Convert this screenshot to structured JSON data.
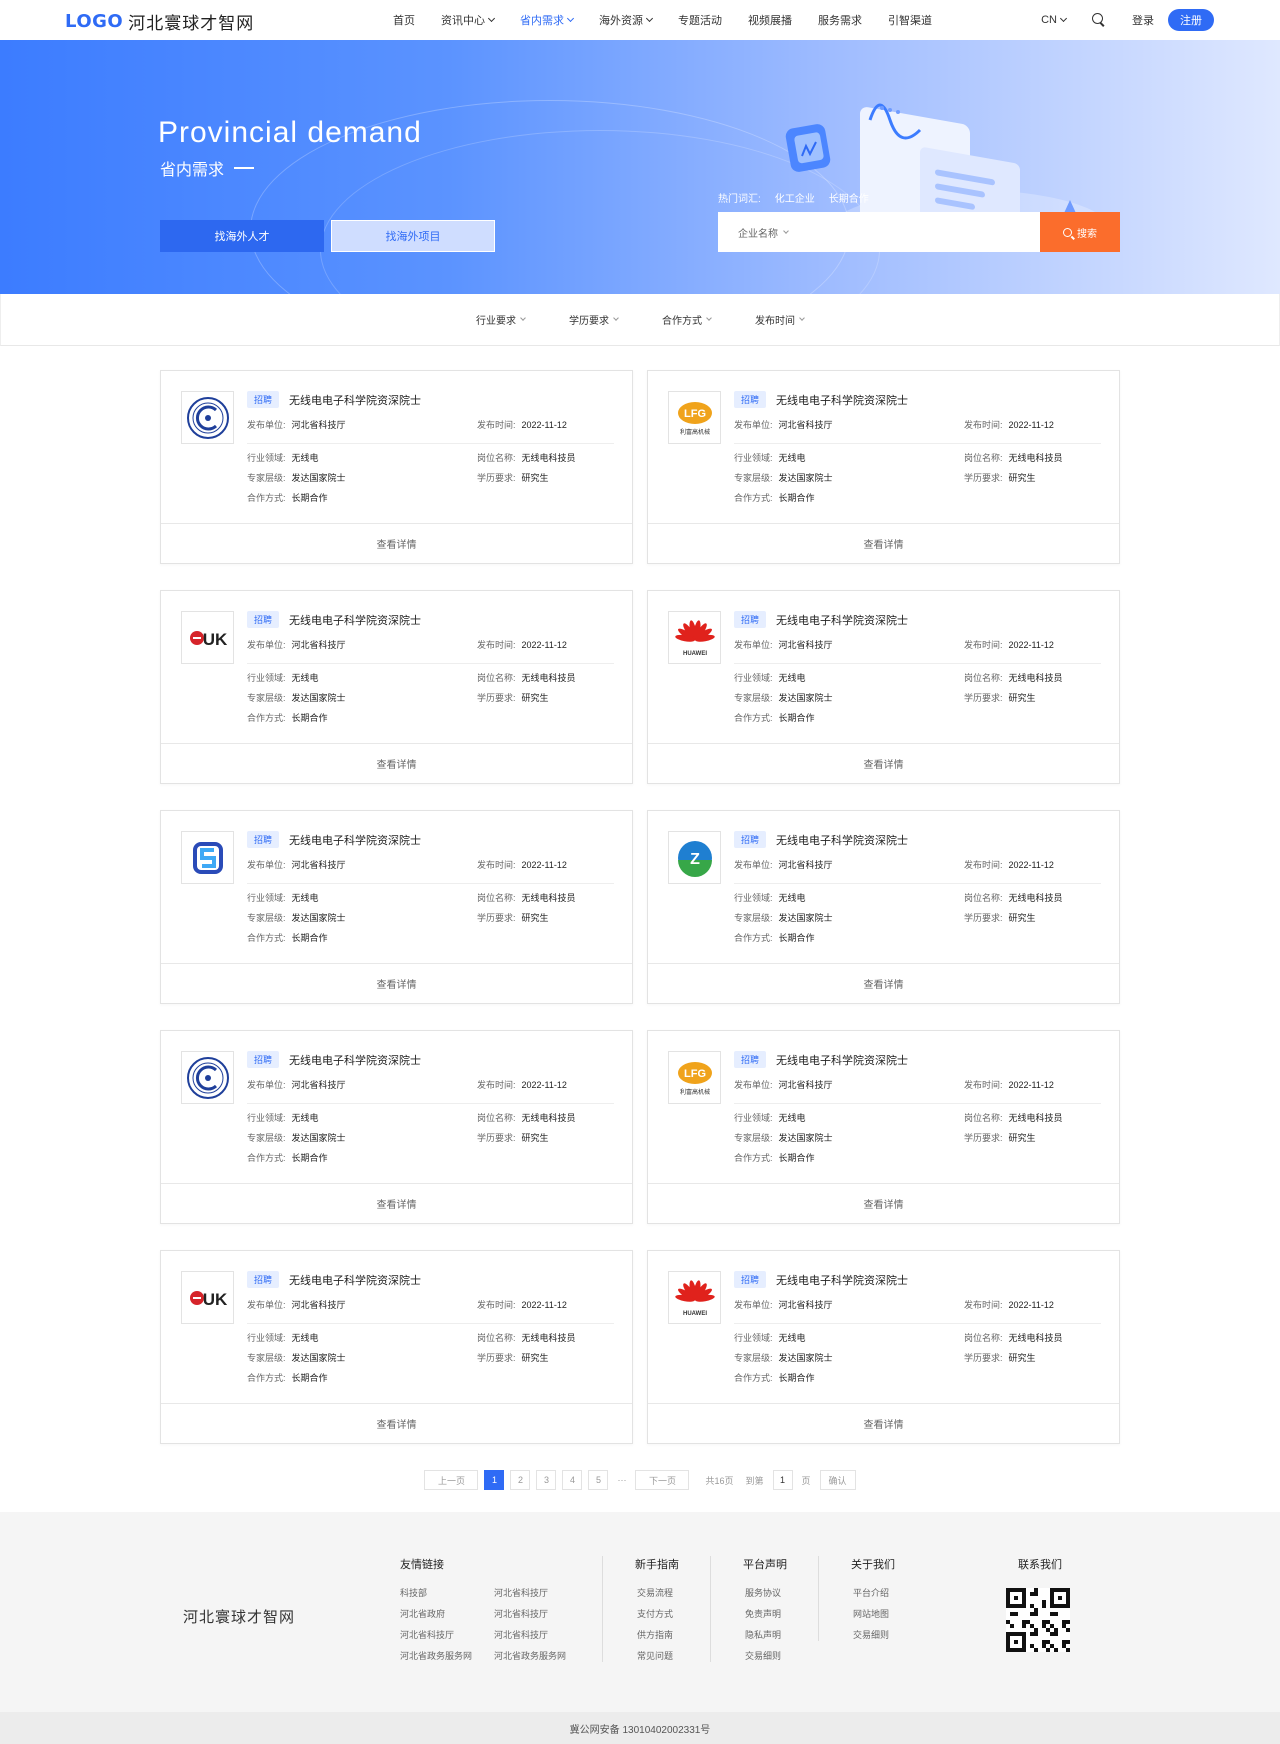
{
  "header": {
    "logo_mark": "LOGO",
    "logo_text": "河北寰球才智网",
    "nav": [
      {
        "label": "首页",
        "chevron": false,
        "active": false
      },
      {
        "label": "资讯中心",
        "chevron": true,
        "active": false
      },
      {
        "label": "省内需求",
        "chevron": true,
        "active": true
      },
      {
        "label": "海外资源",
        "chevron": true,
        "active": false
      },
      {
        "label": "专题活动",
        "chevron": false,
        "active": false
      },
      {
        "label": "视频展播",
        "chevron": false,
        "active": false
      },
      {
        "label": "服务需求",
        "chevron": false,
        "active": false
      },
      {
        "label": "引智渠道",
        "chevron": false,
        "active": false
      }
    ],
    "lang": "CN",
    "login": "登录",
    "register": "注册"
  },
  "banner": {
    "title": "Provincial demand",
    "subtitle": "省内需求",
    "tab_talent": "找海外人才",
    "tab_project": "找海外项目",
    "hot_label": "热门词汇:",
    "hot_words": [
      "化工企业",
      "长期合作"
    ],
    "search_select": "企业名称",
    "search_button": "搜索"
  },
  "filters": [
    "行业要求",
    "学历要求",
    "合作方式",
    "发布时间"
  ],
  "card_labels": {
    "publisher": "发布单位:",
    "publish_time": "发布时间:",
    "industry": "行业领域:",
    "position": "岗位名称:",
    "level": "专家层级:",
    "education": "学历要求:",
    "cooperation": "合作方式:",
    "detail": "查看详情"
  },
  "cards": [
    {
      "logo": "university-seal",
      "tag": "招聘",
      "title": "无线电电子科学院资深院士",
      "publisher": "河北省科技厅",
      "time": "2022-11-12",
      "industry": "无线电",
      "position": "无线电科技员",
      "level": "发达国家院士",
      "education": "研究生",
      "cooperation": "长期合作"
    },
    {
      "logo": "lfg",
      "logo_text": "LFG",
      "logo_sub": "利富高机械",
      "tag": "招聘",
      "title": "无线电电子科学院资深院士",
      "publisher": "河北省科技厅",
      "time": "2022-11-12",
      "industry": "无线电",
      "position": "无线电科技员",
      "level": "发达国家院士",
      "education": "研究生",
      "cooperation": "长期合作"
    },
    {
      "logo": "luk",
      "logo_text": "LUK",
      "tag": "招聘",
      "title": "无线电电子科学院资深院士",
      "publisher": "河北省科技厅",
      "time": "2022-11-12",
      "industry": "无线电",
      "position": "无线电科技员",
      "level": "发达国家院士",
      "education": "研究生",
      "cooperation": "长期合作"
    },
    {
      "logo": "huawei",
      "logo_text": "HUAWEI",
      "tag": "招聘",
      "title": "无线电电子科学院资深院士",
      "publisher": "河北省科技厅",
      "time": "2022-11-12",
      "industry": "无线电",
      "position": "无线电科技员",
      "level": "发达国家院士",
      "education": "研究生",
      "cooperation": "长期合作"
    },
    {
      "logo": "s-blue",
      "tag": "招聘",
      "title": "无线电电子科学院资深院士",
      "publisher": "河北省科技厅",
      "time": "2022-11-12",
      "industry": "无线电",
      "position": "无线电科技员",
      "level": "发达国家院士",
      "education": "研究生",
      "cooperation": "长期合作"
    },
    {
      "logo": "z-globe",
      "logo_text": "Z",
      "tag": "招聘",
      "title": "无线电电子科学院资深院士",
      "publisher": "河北省科技厅",
      "time": "2022-11-12",
      "industry": "无线电",
      "position": "无线电科技员",
      "level": "发达国家院士",
      "education": "研究生",
      "cooperation": "长期合作"
    },
    {
      "logo": "university-seal",
      "tag": "招聘",
      "title": "无线电电子科学院资深院士",
      "publisher": "河北省科技厅",
      "time": "2022-11-12",
      "industry": "无线电",
      "position": "无线电科技员",
      "level": "发达国家院士",
      "education": "研究生",
      "cooperation": "长期合作"
    },
    {
      "logo": "lfg",
      "logo_text": "LFG",
      "logo_sub": "利富高机械",
      "tag": "招聘",
      "title": "无线电电子科学院资深院士",
      "publisher": "河北省科技厅",
      "time": "2022-11-12",
      "industry": "无线电",
      "position": "无线电科技员",
      "level": "发达国家院士",
      "education": "研究生",
      "cooperation": "长期合作"
    },
    {
      "logo": "luk",
      "logo_text": "LUK",
      "tag": "招聘",
      "title": "无线电电子科学院资深院士",
      "publisher": "河北省科技厅",
      "time": "2022-11-12",
      "industry": "无线电",
      "position": "无线电科技员",
      "level": "发达国家院士",
      "education": "研究生",
      "cooperation": "长期合作"
    },
    {
      "logo": "huawei",
      "logo_text": "HUAWEI",
      "tag": "招聘",
      "title": "无线电电子科学院资深院士",
      "publisher": "河北省科技厅",
      "time": "2022-11-12",
      "industry": "无线电",
      "position": "无线电科技员",
      "level": "发达国家院士",
      "education": "研究生",
      "cooperation": "长期合作"
    }
  ],
  "pagination": {
    "prev": "上一页",
    "pages": [
      "1",
      "2",
      "3",
      "4",
      "5"
    ],
    "current": "1",
    "ellipsis": "···",
    "next": "下一页",
    "total": "共16页",
    "goto": "到第",
    "goto_value": "1",
    "page_unit": "页",
    "confirm": "确认"
  },
  "footer": {
    "logo_text": "河北寰球才智网",
    "friend_links": {
      "title": "友情链接",
      "items": [
        "科技部",
        "河北省科技厅",
        "河北省政府",
        "河北省科技厅",
        "河北省科技厅",
        "河北省科技厅",
        "河北省政务服务网",
        "河北省政务服务网"
      ]
    },
    "guide": {
      "title": "新手指南",
      "items": [
        "交易流程",
        "支付方式",
        "供方指南",
        "常见问题"
      ]
    },
    "statement": {
      "title": "平台声明",
      "items": [
        "服务协议",
        "免责声明",
        "隐私声明",
        "交易细则"
      ]
    },
    "about": {
      "title": "关于我们",
      "items": [
        "平台介绍",
        "网站地图",
        "交易细则"
      ]
    },
    "contact_title": "联系我们",
    "copyright": "冀公网安备 13010402002331号"
  },
  "colors": {
    "primary": "#2f6bf5",
    "search_button": "#fb6d2c",
    "tag_bg": "#e6eeff"
  }
}
